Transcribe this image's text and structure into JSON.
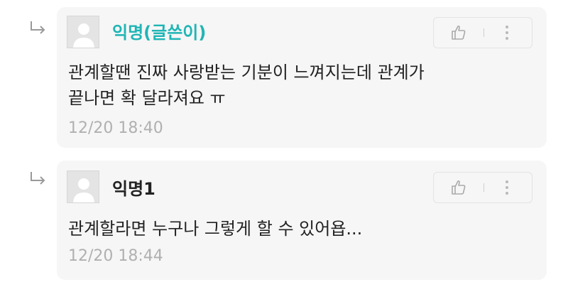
{
  "comments": [
    {
      "author": "익명(글쓴이)",
      "author_color": "#1fb5b5",
      "text_line1": "관계할땐 진짜 사랑받는 기분이 느껴지는데 관계가",
      "text_line2": "끝나면 확 달라져요 ㅠ",
      "time": "12/20 18:40",
      "icons": [
        "reply-arrow-icon",
        "avatar-icon",
        "thumbs-up-icon",
        "more-vertical-icon"
      ]
    },
    {
      "author": "익명1",
      "author_color": "#222222",
      "text_line1": "관계할라면 누구나 그렇게 할 수 있어욥...",
      "time": "12/20 18:44",
      "icons": [
        "reply-arrow-icon",
        "avatar-icon",
        "thumbs-up-icon",
        "more-vertical-icon"
      ]
    }
  ]
}
